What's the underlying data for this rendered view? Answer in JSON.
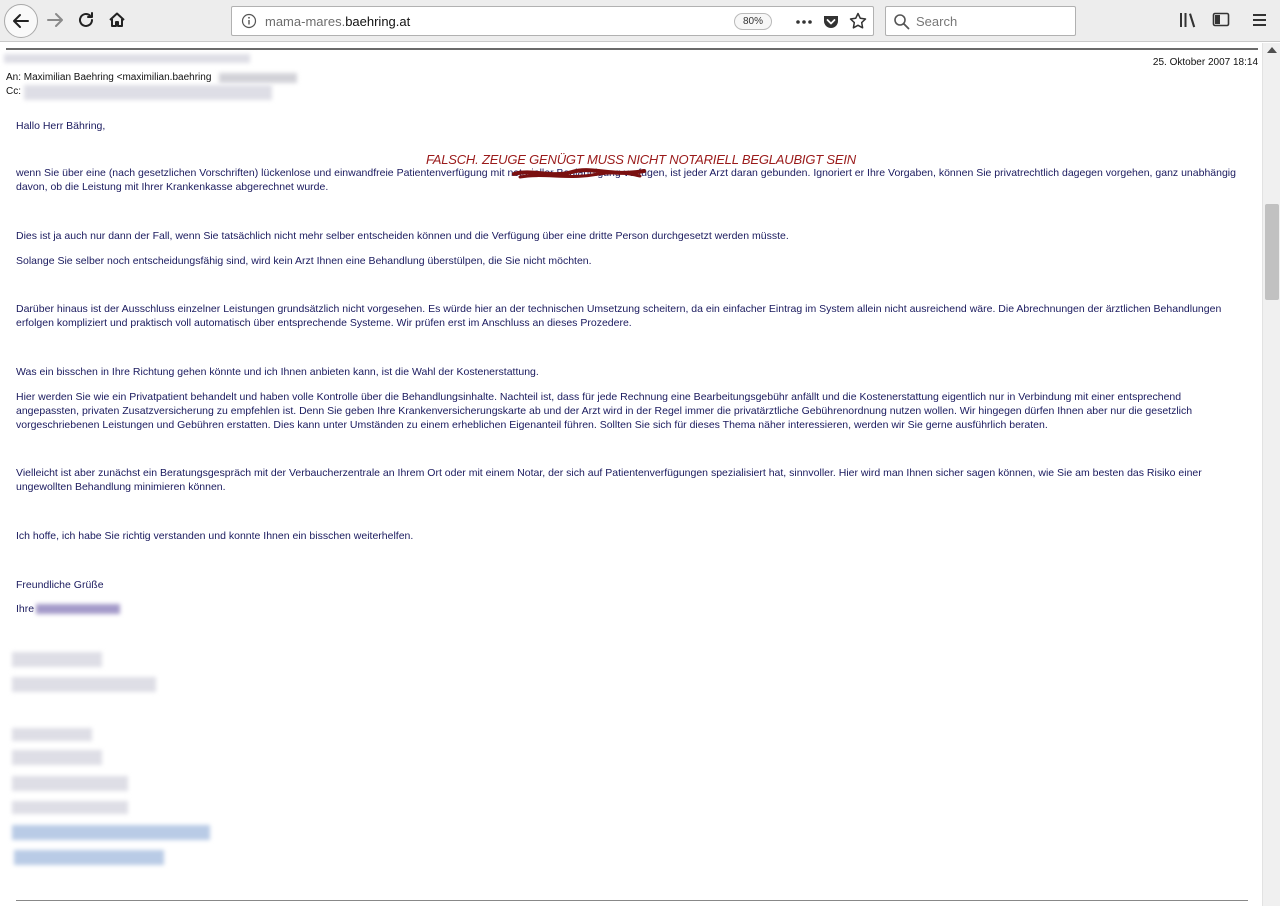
{
  "browser": {
    "url_prefix": "mama-mares.",
    "url_domain": "baehring.at",
    "zoom": "80%",
    "search_placeholder": "Search"
  },
  "email": {
    "to": "An: Maximilian Baehring <maximilian.baehring",
    "cc": "Cc:",
    "date": "25. Oktober 2007 18:14",
    "greeting": "Hallo Herr Bähring,",
    "annotation": "FALSCH. ZEUGE GENÜGT MUSS NICHT NOTARIELL BEGLAUBIGT SEIN",
    "paragraphs": [
      "wenn Sie über eine (nach gesetzlichen Vorschriften) lückenlose und einwandfreie Patientenverfügung mit notarieller Beglaubigung verfügen, ist jeder Arzt daran gebunden. Ignoriert er Ihre Vorgaben, können Sie privatrechtlich dagegen vorgehen, ganz unabhängig davon, ob die Leistung mit Ihrer Krankenkasse abgerechnet wurde.",
      "Dies ist ja auch nur dann der Fall, wenn Sie tatsächlich nicht mehr selber entscheiden können und die Verfügung über eine dritte Person durchgesetzt werden müsste.",
      "Solange Sie selber noch entscheidungsfähig sind, wird kein Arzt Ihnen eine Behandlung überstülpen, die Sie nicht möchten.",
      "Darüber hinaus ist der Ausschluss einzelner Leistungen grundsätzlich nicht vorgesehen. Es würde hier an der technischen Umsetzung scheitern, da ein einfacher Eintrag im System allein nicht ausreichend wäre. Die Abrechnungen der ärztlichen Behandlungen erfolgen kompliziert und praktisch voll automatisch über entsprechende Systeme. Wir prüfen erst im Anschluss an dieses Prozedere.",
      "Was ein bisschen in Ihre Richtung gehen könnte und ich Ihnen anbieten kann, ist die Wahl der Kostenerstattung.",
      "Hier werden Sie wie ein Privatpatient behandelt und haben volle Kontrolle über die Behandlungsinhalte. Nachteil ist, dass für jede Rechnung eine Bearbeitungsgebühr anfällt und die Kostenerstattung eigentlich nur in Verbindung mit einer entsprechend angepassten, privaten Zusatzversicherung zu empfehlen ist. Denn Sie geben Ihre Krankenversicherungskarte ab und der Arzt wird in der Regel immer die privatärztliche Gebührenordnung nutzen wollen. Wir hingegen dürfen Ihnen aber nur die gesetzlich vorgeschriebenen Leistungen und Gebühren erstatten. Dies kann unter Umständen zu einem erheblichen Eigenanteil führen. Sollten Sie sich für dieses Thema näher interessieren, werden wir Sie gerne ausführlich beraten.",
      "Vielleicht ist aber zunächst ein Beratungsgespräch mit der Verbaucherzentrale an Ihrem Ort oder mit einem Notar, der sich auf Patientenverfügungen spezialisiert hat, sinnvoller. Hier wird man Ihnen sicher sagen können, wie Sie am besten das Risiko einer ungewollten Behandlung minimieren können.",
      "Ich hoffe, ich habe Sie richtig verstanden und konnte Ihnen ein bisschen weiterhelfen."
    ],
    "closing": "Freundliche Grüße",
    "signature_prefix": "Ihre"
  },
  "colors": {
    "body_text": "#1a1a5e",
    "annotation": "#9a1a1a"
  },
  "icons": [
    "back-arrow-icon",
    "forward-arrow-icon",
    "reload-icon",
    "home-icon",
    "info-icon",
    "ellipsis-icon",
    "pocket-icon",
    "star-icon",
    "search-icon",
    "library-icon",
    "sidebar-icon",
    "hamburger-menu-icon"
  ]
}
